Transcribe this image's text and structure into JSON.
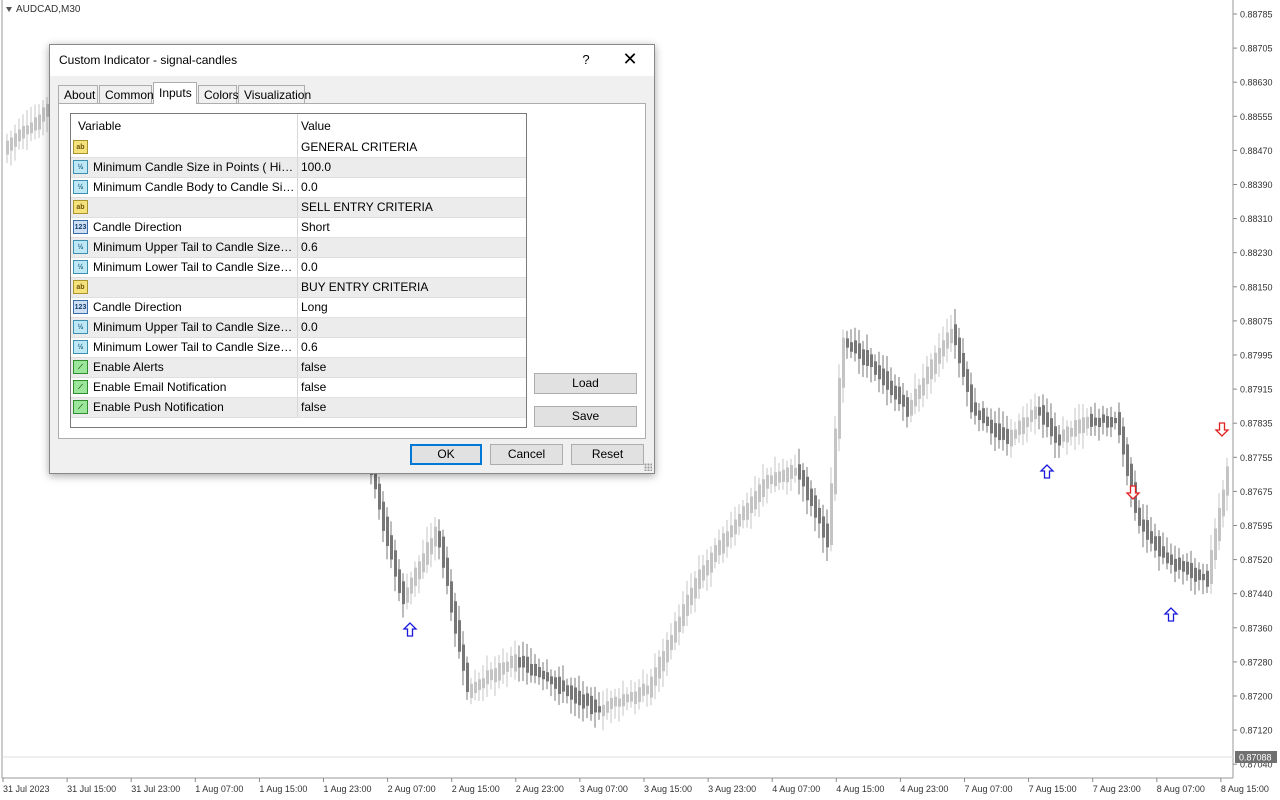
{
  "chart": {
    "symbol": "AUDCAD,M30",
    "price_labels": [
      "0.88785",
      "0.88705",
      "0.88630",
      "0.88555",
      "0.88470",
      "0.88390",
      "0.88310",
      "0.88230",
      "0.88150",
      "0.88075",
      "0.87995",
      "0.87915",
      "0.87835",
      "0.87755",
      "0.87675",
      "0.87595",
      "0.87520",
      "0.87440",
      "0.87360",
      "0.87280",
      "0.87200",
      "0.87120",
      "0.87040"
    ],
    "current_price": "0.87088",
    "time_labels": [
      "31 Jul 2023",
      "31 Jul 15:00",
      "31 Jul 23:00",
      "1 Aug 07:00",
      "1 Aug 15:00",
      "1 Aug 23:00",
      "2 Aug 07:00",
      "2 Aug 15:00",
      "2 Aug 23:00",
      "3 Aug 07:00",
      "3 Aug 15:00",
      "3 Aug 23:00",
      "4 Aug 07:00",
      "4 Aug 15:00",
      "4 Aug 23:00",
      "7 Aug 07:00",
      "7 Aug 15:00",
      "7 Aug 23:00",
      "8 Aug 07:00",
      "8 Aug 15:00"
    ],
    "colors": {
      "bull": "#c4c4c4",
      "bear": "#777777",
      "buy_arrow": "#1a1adb",
      "sell_arrow": "#e02020",
      "price_tag": "#707070"
    }
  },
  "dialog": {
    "title": "Custom Indicator - signal-candles",
    "help": "?",
    "close": "✕",
    "tabs": [
      "About",
      "Common",
      "Inputs",
      "Colors",
      "Visualization"
    ],
    "active_tab": "Inputs",
    "grid": {
      "headers": {
        "variable": "Variable",
        "value": "Value"
      },
      "rows": [
        {
          "icon": "ab",
          "label": "",
          "value": "GENERAL CRITERIA"
        },
        {
          "icon": "dbl",
          "label": "Minimum Candle Size in Points ( High - L...",
          "value": "100.0"
        },
        {
          "icon": "dbl",
          "label": "Minimum Candle Body to Candle Size Ra...",
          "value": "0.0"
        },
        {
          "icon": "ab",
          "label": "",
          "value": "SELL ENTRY CRITERIA"
        },
        {
          "icon": "int",
          "label": "Candle Direction",
          "value": "Short"
        },
        {
          "icon": "dbl",
          "label": "Minimum Upper Tail to Candle Size Ratio",
          "value": "0.6"
        },
        {
          "icon": "dbl",
          "label": "Minimum Lower Tail to Candle Size Ratio",
          "value": "0.0"
        },
        {
          "icon": "ab",
          "label": "",
          "value": "BUY ENTRY CRITERIA"
        },
        {
          "icon": "int",
          "label": "Candle Direction",
          "value": "Long"
        },
        {
          "icon": "dbl",
          "label": "Minimum Upper Tail to Candle Size Ratio",
          "value": "0.0"
        },
        {
          "icon": "dbl",
          "label": "Minimum Lower Tail to Candle Size Ratio",
          "value": "0.6"
        },
        {
          "icon": "bool",
          "label": "Enable Alerts",
          "value": "false"
        },
        {
          "icon": "bool",
          "label": "Enable Email Notification",
          "value": "false"
        },
        {
          "icon": "bool",
          "label": "Enable Push Notification",
          "value": "false"
        }
      ]
    },
    "buttons": {
      "load": "Load",
      "save": "Save",
      "ok": "OK",
      "cancel": "Cancel",
      "reset": "Reset"
    },
    "icon_glyphs": {
      "ab": "ab",
      "dbl": "½",
      "int": "123",
      "bool": "⟋"
    }
  }
}
